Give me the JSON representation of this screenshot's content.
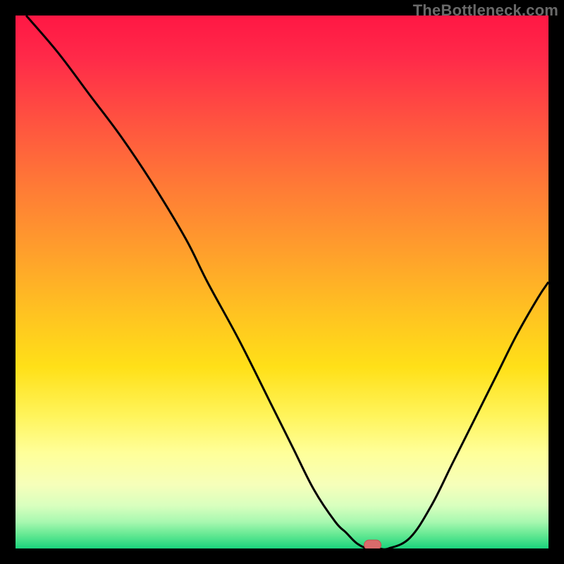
{
  "watermark": "TheBottleneck.com",
  "colors": {
    "frame_bg": "#000000",
    "plot_bg": "#ffffff",
    "curve": "#000000",
    "marker_fill": "#d86b6b",
    "marker_stroke": "#c84f4f",
    "gradient_stops": [
      {
        "offset": 0.0,
        "color": "#ff1744"
      },
      {
        "offset": 0.08,
        "color": "#ff2a49"
      },
      {
        "offset": 0.2,
        "color": "#ff5340"
      },
      {
        "offset": 0.32,
        "color": "#ff7a36"
      },
      {
        "offset": 0.44,
        "color": "#ff9e2c"
      },
      {
        "offset": 0.56,
        "color": "#ffc321"
      },
      {
        "offset": 0.66,
        "color": "#ffe018"
      },
      {
        "offset": 0.75,
        "color": "#fff45a"
      },
      {
        "offset": 0.82,
        "color": "#ffff99"
      },
      {
        "offset": 0.88,
        "color": "#f6ffba"
      },
      {
        "offset": 0.92,
        "color": "#d8ffbe"
      },
      {
        "offset": 0.95,
        "color": "#a8f8b0"
      },
      {
        "offset": 0.975,
        "color": "#62e892"
      },
      {
        "offset": 1.0,
        "color": "#1ad37c"
      }
    ]
  },
  "chart_data": {
    "type": "line",
    "title": "",
    "xlabel": "",
    "ylabel": "",
    "xlim": [
      0,
      100
    ],
    "ylim": [
      0,
      100
    ],
    "x": [
      2,
      8,
      14,
      20,
      26,
      32,
      36,
      42,
      48,
      52,
      56,
      60,
      62,
      64,
      66,
      68,
      70,
      74,
      78,
      82,
      86,
      90,
      94,
      98,
      100
    ],
    "values": [
      100,
      93,
      85,
      77,
      68,
      58,
      50,
      39,
      27,
      19,
      11,
      5,
      3,
      1,
      0,
      0,
      0,
      2,
      8,
      16,
      24,
      32,
      40,
      47,
      50
    ],
    "series": [
      {
        "name": "bottleneck-curve",
        "x_ref": "x",
        "y_ref": "values"
      }
    ],
    "marker": {
      "x": 67,
      "y": 0,
      "shape": "rounded-rect"
    },
    "annotations": []
  }
}
